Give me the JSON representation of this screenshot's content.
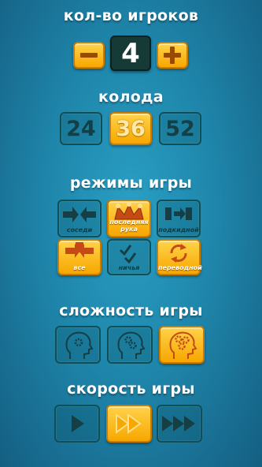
{
  "players": {
    "title": "кол-во игроков",
    "count": "4",
    "minus_icon": "minus-icon",
    "plus_icon": "plus-icon"
  },
  "deck": {
    "title": "колода",
    "options": [
      "24",
      "36",
      "52"
    ],
    "selected": "36"
  },
  "modes": {
    "title": "режимы игры",
    "items": [
      {
        "label": "соседи",
        "icon": "neighbors-arrows-icon",
        "selected": false
      },
      {
        "label": "последняя рука",
        "icon": "jester-hat-icon",
        "selected": true
      },
      {
        "label": "подкидной",
        "icon": "throw-in-icon",
        "selected": false
      },
      {
        "label": "все",
        "icon": "all-arrows-icon",
        "selected": true
      },
      {
        "label": "ничья",
        "icon": "checkmark-icon",
        "selected": false
      },
      {
        "label": "переводной",
        "icon": "transfer-cycle-icon",
        "selected": true
      }
    ]
  },
  "difficulty": {
    "title": "сложность игры",
    "levels": [
      "easy",
      "medium",
      "hard"
    ],
    "selected": "hard"
  },
  "speed": {
    "title": "скорость игры",
    "levels": [
      "slow",
      "normal",
      "fast"
    ],
    "selected": "normal"
  },
  "colors": {
    "background": "#1f86ab",
    "accent": "#f7a700",
    "inactive_border": "#0f4f55"
  }
}
